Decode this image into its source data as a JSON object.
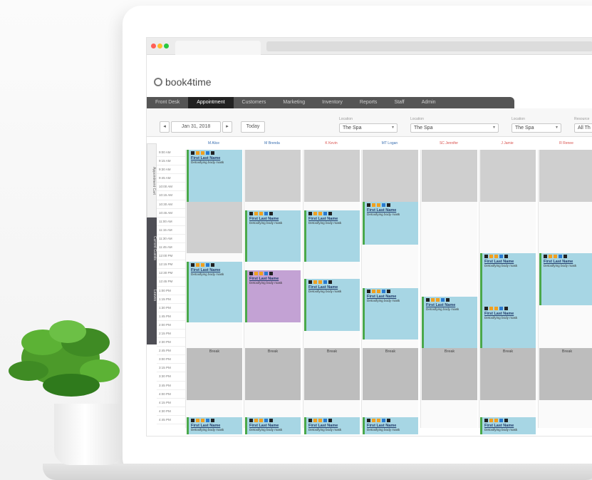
{
  "app": {
    "logo": "book4time"
  },
  "window": {
    "dot_colors": [
      "#ff5f56",
      "#ffbd2e",
      "#27c93f"
    ]
  },
  "nav": {
    "items": [
      "Front Desk",
      "Appointment",
      "Customers",
      "Marketing",
      "Inventory",
      "Reports",
      "Staff",
      "Admin"
    ],
    "active": "Appointment"
  },
  "toolbar": {
    "prev": "◂",
    "date": "Jan 31, 2018",
    "next": "▸",
    "today": "Today",
    "location_label": "Location",
    "selects": [
      {
        "value": "The Spa"
      },
      {
        "value": "The Spa"
      },
      {
        "value": "The Spa"
      },
      {
        "value": "All Th"
      }
    ],
    "resource_label": "Resource"
  },
  "sidebar": {
    "tabs": [
      "Appointment Cart",
      "Current Guests",
      "Leaves"
    ]
  },
  "schedule": {
    "times": [
      "9:00 AM",
      "9:15 AM",
      "9:30 AM",
      "9:45 AM",
      "10:00 AM",
      "10:15 AM",
      "10:30 AM",
      "10:45 AM",
      "11:00 AM",
      "11:15 AM",
      "11:30 AM",
      "11:45 AM",
      "12:00 PM",
      "12:15 PM",
      "12:30 PM",
      "12:45 PM",
      "1:00 PM",
      "1:15 PM",
      "1:30 PM",
      "1:45 PM",
      "2:00 PM",
      "2:15 PM",
      "2:30 PM",
      "2:45 PM",
      "3:00 PM",
      "3:15 PM",
      "3:30 PM",
      "3:45 PM",
      "4:00 PM",
      "4:15 PM",
      "4:30 PM",
      "4:45 PM"
    ],
    "columns": [
      "M Alice",
      "M Brenda",
      "K Kevin",
      "MT Logan",
      "SC Jennifer",
      "J Jamie",
      "R Renee"
    ],
    "header_colors": [
      "#3a6fb0",
      "#3a6fb0",
      "#d9534f",
      "#3a6fb0",
      "#d9534f",
      "#d9534f",
      "#d9534f"
    ],
    "appt_name": "First Last Name",
    "appt_desc": "Detoxifying body mask",
    "break_label": "Break"
  }
}
